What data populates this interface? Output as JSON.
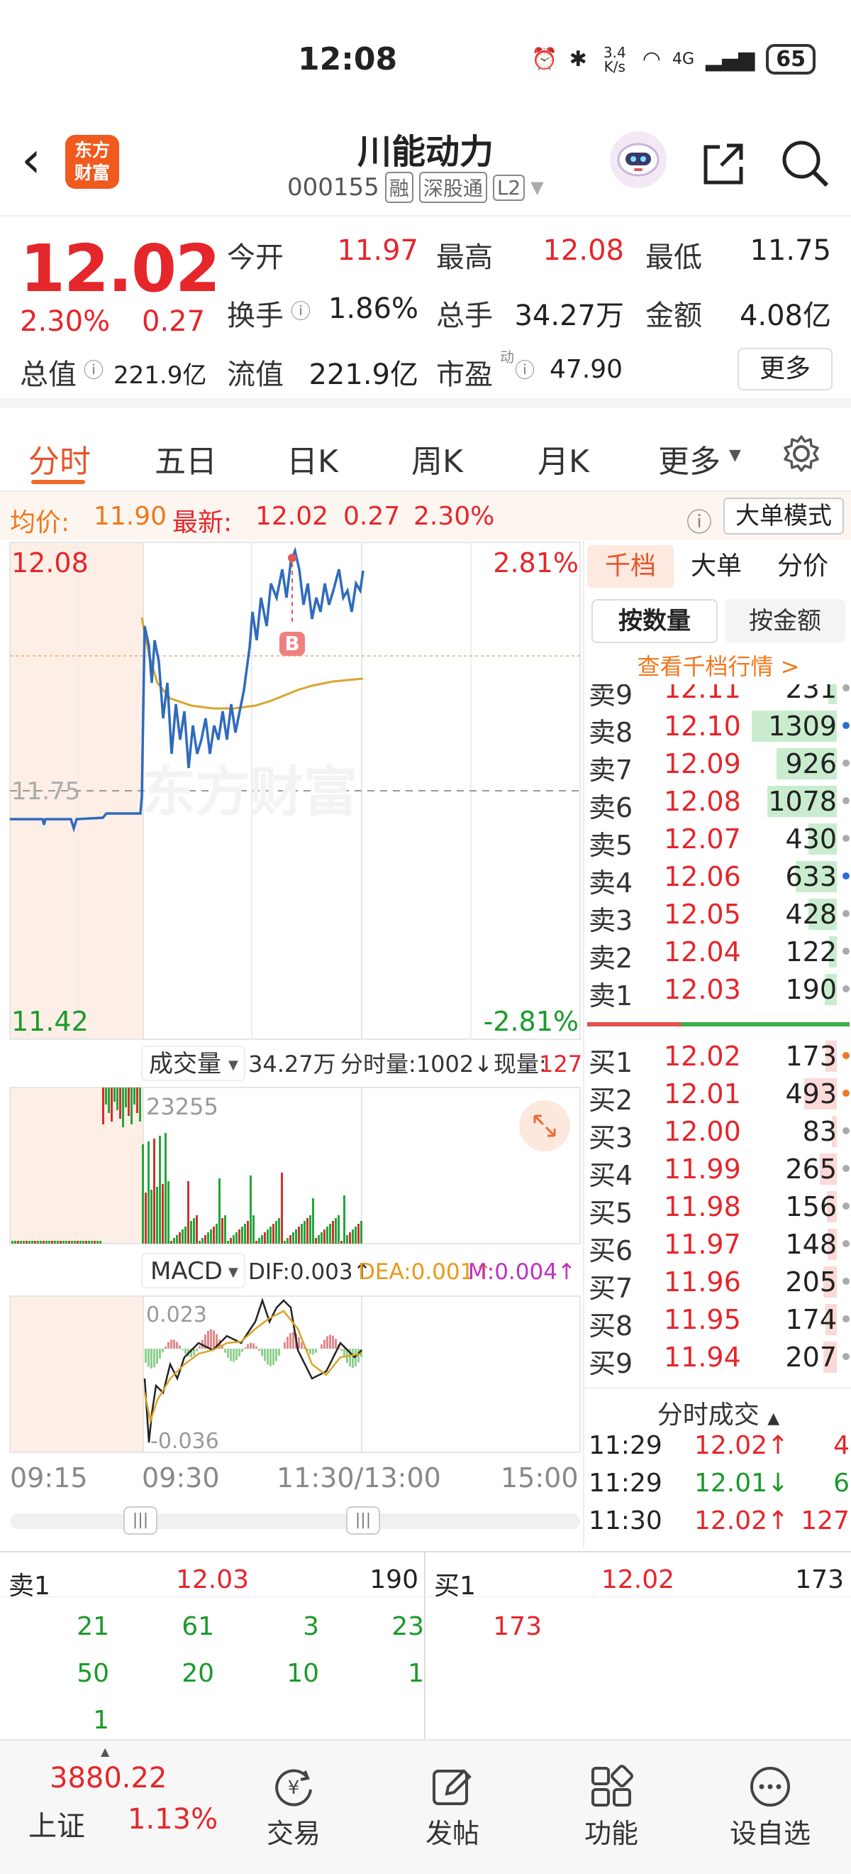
{
  "status": {
    "time": "12:08",
    "net_speed": "3.4 K/s",
    "net_type": "4G",
    "battery": "65"
  },
  "header": {
    "stock_name": "川能动力",
    "code": "000155",
    "tags": [
      "融",
      "深股通",
      "L2"
    ],
    "logo_text_1": "东方",
    "logo_text_2": "财富"
  },
  "quote": {
    "price": "12.02",
    "change_pct": "2.30%",
    "change": "0.27",
    "open_label": "今开",
    "open": "11.97",
    "high_label": "最高",
    "high": "12.08",
    "low_label": "最低",
    "low": "11.75",
    "turnover_label": "换手",
    "turnover": "1.86%",
    "volume_label": "总手",
    "volume": "34.27万",
    "amount_label": "金额",
    "amount": "4.08亿",
    "mktcap_label": "总值",
    "mktcap": "221.9亿",
    "float_label": "流值",
    "float": "221.9亿",
    "pe_label": "市盈",
    "pe_sup": "动",
    "pe": "47.90",
    "more": "更多"
  },
  "tabs": [
    "分时",
    "五日",
    "日K",
    "周K",
    "月K",
    "更多"
  ],
  "avgline": {
    "avg_label": "均价:",
    "avg": "11.90",
    "last_label": "最新:",
    "last": "12.02",
    "chg": "0.27",
    "pct": "2.30%",
    "mode": "大单模式"
  },
  "chart": {
    "ymax": "12.08",
    "ymin": "11.42",
    "pmax": "2.81%",
    "pmin": "-2.81%",
    "ref": "11.75",
    "watermark": "东方财富",
    "marker": "B",
    "vol_label": "成交量",
    "vol_total": "34.27万",
    "vol_min_label": "分时量:1002↓",
    "vol_now_label": "现量:",
    "vol_now": "127",
    "vol_max": "23255",
    "macd_label": "MACD",
    "dif": "DIF:0.003↑",
    "dea": "DEA:0.001↑",
    "m": "M:0.004↑",
    "macd_max": "0.023",
    "macd_min": "-0.036",
    "times": [
      "09:15",
      "09:30",
      "11:30/13:00",
      "15:00"
    ]
  },
  "orderbook": {
    "tabs": [
      "千档",
      "大单",
      "分价"
    ],
    "subtabs": [
      "按数量",
      "按金额"
    ],
    "link": "查看千档行情 >",
    "asks": [
      {
        "label": "卖9",
        "price": "12.11",
        "vol": "231",
        "w": 0.1
      },
      {
        "label": "卖8",
        "price": "12.10",
        "vol": "1309",
        "w": 1.0,
        "dot": "#2a6fd6"
      },
      {
        "label": "卖7",
        "price": "12.09",
        "vol": "926",
        "w": 0.71
      },
      {
        "label": "卖6",
        "price": "12.08",
        "vol": "1078",
        "w": 0.82
      },
      {
        "label": "卖5",
        "price": "12.07",
        "vol": "430",
        "w": 0.33
      },
      {
        "label": "卖4",
        "price": "12.06",
        "vol": "633",
        "w": 0.48,
        "dot": "#2a6fd6"
      },
      {
        "label": "卖3",
        "price": "12.05",
        "vol": "428",
        "w": 0.33
      },
      {
        "label": "卖2",
        "price": "12.04",
        "vol": "122",
        "w": 0.09
      },
      {
        "label": "卖1",
        "price": "12.03",
        "vol": "190",
        "w": 0.14
      }
    ],
    "bids": [
      {
        "label": "买1",
        "price": "12.02",
        "vol": "173",
        "w": 0.13,
        "dot": "#f0781e"
      },
      {
        "label": "买2",
        "price": "12.01",
        "vol": "493",
        "w": 0.38,
        "dot": "#f0781e"
      },
      {
        "label": "买3",
        "price": "12.00",
        "vol": "83",
        "w": 0.06
      },
      {
        "label": "买4",
        "price": "11.99",
        "vol": "265",
        "w": 0.2
      },
      {
        "label": "买5",
        "price": "11.98",
        "vol": "156",
        "w": 0.12
      },
      {
        "label": "买6",
        "price": "11.97",
        "vol": "148",
        "w": 0.11
      },
      {
        "label": "买7",
        "price": "11.96",
        "vol": "205",
        "w": 0.16
      },
      {
        "label": "买8",
        "price": "11.95",
        "vol": "174",
        "w": 0.13
      },
      {
        "label": "买9",
        "price": "11.94",
        "vol": "207",
        "w": 0.16
      }
    ],
    "trades_title": "分时成交",
    "trades": [
      {
        "time": "11:29",
        "price": "12.02↑",
        "vol": "4",
        "color": "#e5262b"
      },
      {
        "time": "11:29",
        "price": "12.01↓",
        "vol": "6",
        "color": "#1a9a2a"
      },
      {
        "time": "11:30",
        "price": "12.02↑",
        "vol": "127",
        "color": "#e5262b"
      }
    ]
  },
  "queue": {
    "sell_label": "卖1",
    "sell_price": "12.03",
    "sell_vol": "190",
    "buy_label": "买1",
    "buy_price": "12.02",
    "buy_vol": "173",
    "sell_orders": [
      "21",
      "61",
      "3",
      "23",
      "50",
      "20",
      "10",
      "1",
      "1"
    ],
    "buy_orders": [
      "173"
    ]
  },
  "nav": {
    "index_value": "3880.22",
    "index_name": "上证",
    "index_pct": "1.13%",
    "items": [
      "交易",
      "发帖",
      "功能",
      "设自选"
    ]
  }
}
